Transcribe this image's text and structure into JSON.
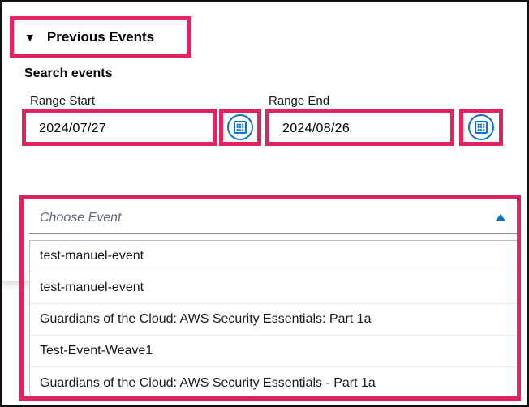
{
  "section": {
    "title": "Previous Events"
  },
  "search": {
    "title": "Search events",
    "range_start_label": "Range Start",
    "range_end_label": "Range End",
    "range_start_value": "2024/07/27",
    "range_end_value": "2024/08/26"
  },
  "event_select": {
    "placeholder": "Choose Event",
    "options": [
      "test-manuel-event",
      "test-manuel-event",
      "Guardians of the Cloud: AWS Security Essentials: Part 1a",
      "Test-Event-Weave1",
      "Guardians of the Cloud: AWS Security Essentials - Part 1a"
    ]
  },
  "colors": {
    "highlight": "#e0245e",
    "accent": "#0972d3"
  },
  "icons": {
    "caret": "caret-down-icon",
    "calendar": "calendar-icon",
    "select_arrow": "caret-up-icon"
  }
}
